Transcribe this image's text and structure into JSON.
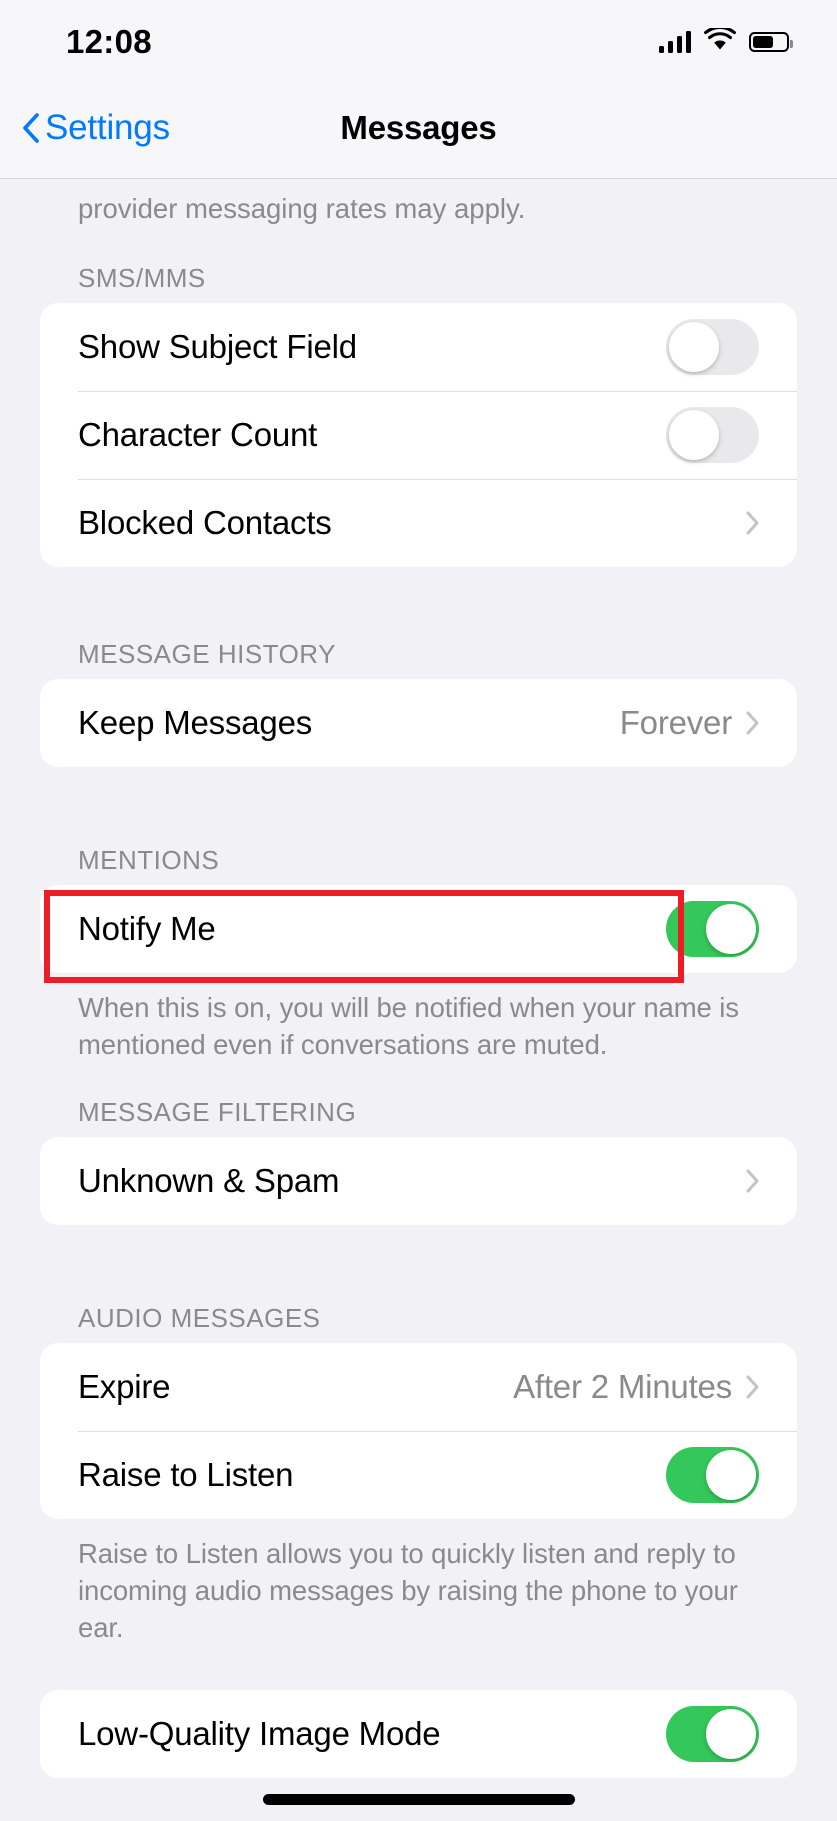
{
  "status_bar": {
    "time": "12:08",
    "cellular_icon": "cellular-bars-icon",
    "wifi_icon": "wifi-icon",
    "battery_icon": "battery-icon"
  },
  "nav": {
    "back_label": "Settings",
    "title": "Messages"
  },
  "partial_footnote": "provider messaging rates may apply.",
  "sections": [
    {
      "header": "SMS/MMS",
      "rows": [
        {
          "label": "Show Subject Field",
          "type": "toggle",
          "state": "off"
        },
        {
          "label": "Character Count",
          "type": "toggle",
          "state": "off"
        },
        {
          "label": "Blocked Contacts",
          "type": "link"
        }
      ]
    },
    {
      "header": "MESSAGE HISTORY",
      "rows": [
        {
          "label": "Keep Messages",
          "type": "value",
          "value": "Forever"
        }
      ]
    },
    {
      "header": "MENTIONS",
      "rows": [
        {
          "label": "Notify Me",
          "type": "toggle",
          "state": "on"
        }
      ],
      "footnote": "When this is on, you will be notified when your name is mentioned even if conversations are muted."
    },
    {
      "header": "MESSAGE FILTERING",
      "rows": [
        {
          "label": "Unknown & Spam",
          "type": "link"
        }
      ]
    },
    {
      "header": "AUDIO MESSAGES",
      "rows": [
        {
          "label": "Expire",
          "type": "value",
          "value": "After 2 Minutes"
        },
        {
          "label": "Raise to Listen",
          "type": "toggle",
          "state": "on"
        }
      ],
      "footnote": "Raise to Listen allows you to quickly listen and reply to incoming audio messages by raising the phone to your ear."
    },
    {
      "header": "",
      "rows": [
        {
          "label": "Low-Quality Image Mode",
          "type": "toggle",
          "state": "on"
        }
      ]
    }
  ],
  "annotation": {
    "kind": "red-highlight-rectangle",
    "target_label": "Notify Me",
    "color": "#ee1c25"
  },
  "colors": {
    "accent_blue": "#007aff",
    "toggle_on_green": "#34c759",
    "toggle_off_gray": "#e9e9eb",
    "page_background": "#f2f1f6",
    "card_background": "#ffffff",
    "secondary_text": "#8a8a8e"
  }
}
